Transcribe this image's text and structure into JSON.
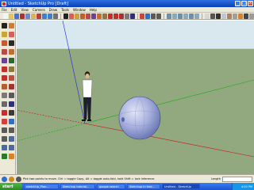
{
  "window": {
    "title": "Untitled - SketchUp Pro [Draft]",
    "minimize_glyph": "_",
    "maximize_glyph": "□",
    "close_glyph": "×"
  },
  "menubar": {
    "items": [
      "File",
      "Edit",
      "View",
      "Camera",
      "Draw",
      "Tools",
      "Window",
      "Help"
    ]
  },
  "statusbar": {
    "hint": "Pick two points to move.  Ctrl = toggle Copy, Alt = toggle auto-fold, hold Shift = lock inference.",
    "measurements_label": "Length",
    "measurements_value": ""
  },
  "taskbar": {
    "start_label": "start",
    "tasks": [
      "sketchUp_Plan...",
      "Sketchup tutorial...",
      "google search",
      "Sketchup in free...",
      "Untitled - SketchUp"
    ],
    "active_task_index": 4,
    "clock": "4:20 PM"
  },
  "icons": {
    "toolbar": [
      "new-icon",
      "open-icon",
      "save-icon",
      "cut-icon",
      "copy-icon",
      "paste-icon",
      "erase-icon",
      "undo-icon",
      "redo-icon",
      "print-icon",
      "select-icon",
      "eraser-icon",
      "paint-bucket-icon",
      "rectangle-icon",
      "circle-icon",
      "polygon-icon",
      "arc-icon",
      "push-pull-icon",
      "move-icon",
      "rotate-icon",
      "offset-icon",
      "tape-measure-icon",
      "text-icon",
      "orbit-icon",
      "pan-icon",
      "zoom-icon",
      "zoom-extents-icon",
      "iso-view-icon",
      "top-view-icon",
      "front-view-icon",
      "right-view-icon",
      "back-view-icon",
      "left-view-icon",
      "xray-icon",
      "wireframe-icon",
      "hidden-line-icon",
      "shaded-icon",
      "textured-icon",
      "monochrome-icon",
      "section-plane-icon",
      "shadows-icon",
      "fog-icon"
    ],
    "left": [
      "select-icon",
      "component-icon",
      "paint-bucket-icon",
      "eraser-icon",
      "rectangle-icon",
      "line-icon",
      "circle-icon",
      "arc-icon",
      "polygon-icon",
      "freehand-icon",
      "move-icon",
      "push-pull-icon",
      "rotate-icon",
      "follow-me-icon",
      "scale-icon",
      "offset-icon",
      "tape-measure-icon",
      "dimension-icon",
      "protractor-icon",
      "text-icon",
      "axes-icon",
      "3d-text-icon",
      "orbit-icon",
      "pan-icon",
      "zoom-icon",
      "zoom-window-icon",
      "zoom-extents-icon",
      "previous-view-icon",
      "position-camera-icon",
      "walk-icon",
      "look-around-icon",
      "section-plane-icon"
    ]
  },
  "colors": {
    "sky": "#d8e8ee",
    "ground": "#92a97f",
    "axis_red": "#d01010",
    "axis_green": "#10b010",
    "axis_blue": "#2020e0",
    "sphere": "#a9b2de",
    "title_blue": "#0a3fb8",
    "taskbar_blue": "#2a63e0"
  }
}
